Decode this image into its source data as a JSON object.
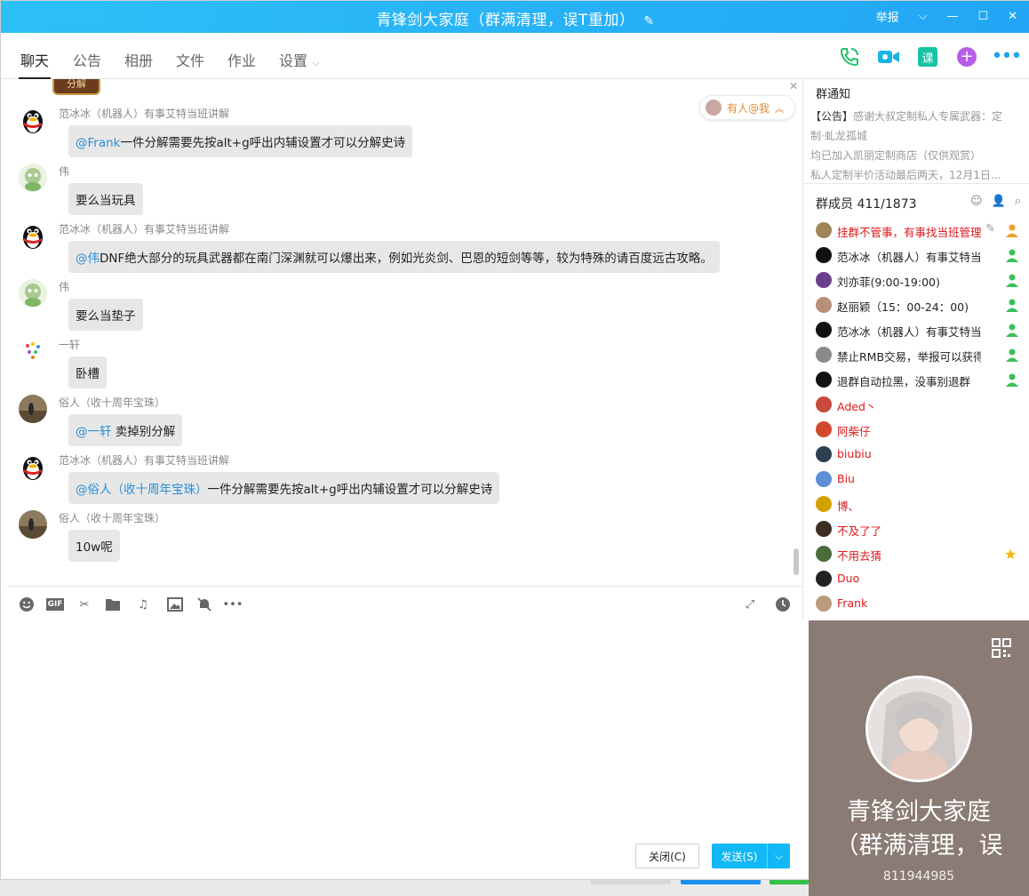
{
  "window": {
    "title": "青锋剑大家庭（群满清理，误T重加）",
    "report": "举报"
  },
  "tabs": [
    "聊天",
    "公告",
    "相册",
    "文件",
    "作业",
    "设置"
  ],
  "chat": {
    "top_badge": "分解",
    "mention_pill": "有人@我",
    "messages": [
      {
        "sender": "范冰冰（机器人）有事艾特当班讲解",
        "at": "@Frank",
        "text": "一件分解需要先按alt+g呼出内辅设置才可以分解史诗",
        "avatar": "penguin"
      },
      {
        "sender": "伟",
        "at": "",
        "text": "要么当玩具",
        "avatar": "green"
      },
      {
        "sender": "范冰冰（机器人）有事艾特当班讲解",
        "at": "@伟",
        "text": "DNF绝大部分的玩具武器都在南门深渊就可以爆出来，例如光炎剑、巴恩的短剑等等，较为特殊的请百度远古攻略。",
        "avatar": "penguin"
      },
      {
        "sender": "伟",
        "at": "",
        "text": "要么当垫子",
        "avatar": "green"
      },
      {
        "sender": "一轩",
        "at": "",
        "text": "卧槽",
        "avatar": "dots"
      },
      {
        "sender": "俗人（收十周年宝珠）",
        "at": "@一轩",
        "text": " 卖掉别分解",
        "avatar": "photo"
      },
      {
        "sender": "范冰冰（机器人）有事艾特当班讲解",
        "at": "@俗人（收十周年宝珠）",
        "text": "一件分解需要先按alt+g呼出内辅设置才可以分解史诗",
        "avatar": "penguin"
      },
      {
        "sender": "俗人（收十周年宝珠）",
        "at": "",
        "text": "10w呢",
        "avatar": "photo"
      }
    ]
  },
  "buttons": {
    "close": "关闭(C)",
    "send": "发送(S)"
  },
  "notice": {
    "heading": "群通知",
    "tag": "【公告】",
    "line1": "感谢大叔定制私人专属武器：定",
    "line2": "制·虬龙孤城",
    "line3": "均已加入凯丽定制商店（仅供观赏）",
    "line4": "私人定制半价活动最后两天，12月1日..."
  },
  "members": {
    "heading": "群成员 411/1873",
    "list": [
      {
        "name": "挂群不管事，有事找当班管理",
        "red": true
      },
      {
        "name": "范冰冰（机器人）有事艾特当班讲解",
        "red": false
      },
      {
        "name": "刘亦菲(9:00-19:00)",
        "red": false
      },
      {
        "name": "赵丽颖（15：00-24：00)",
        "red": false
      },
      {
        "name": "范冰冰（机器人）有事艾特当班讲解",
        "red": false
      },
      {
        "name": "禁止RMB交易，举报可以获得奖励",
        "red": false
      },
      {
        "name": "退群自动拉黑，没事别退群",
        "red": false
      },
      {
        "name": "Aded丶",
        "red": true
      },
      {
        "name": "阿柴仔",
        "red": true
      },
      {
        "name": "biubiu",
        "red": true
      },
      {
        "name": "Biu",
        "red": true
      },
      {
        "name": "博、",
        "red": true
      },
      {
        "name": "不及了了",
        "red": true
      },
      {
        "name": "不用去猜",
        "red": true
      },
      {
        "name": "Duo",
        "red": true
      },
      {
        "name": "Frank",
        "red": true
      }
    ]
  },
  "card": {
    "name_line1": "青锋剑大家庭",
    "name_line2": "（群满清理，误",
    "number": "811944985"
  },
  "colors": {
    "titlebar": "#22a6f5",
    "send": "#12b7f5",
    "card_bg": "#8a7b74",
    "member_red": "#e0181b",
    "mention": "#2c8fd6"
  }
}
